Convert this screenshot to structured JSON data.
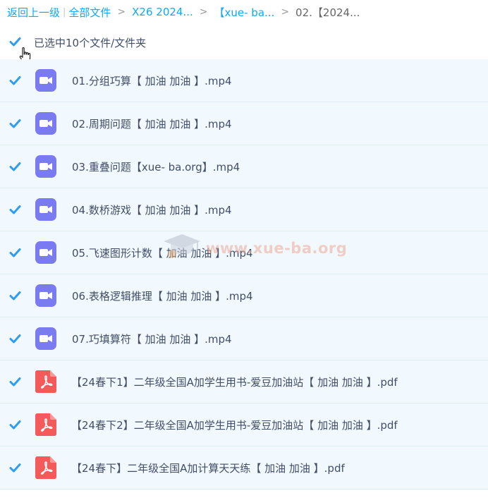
{
  "breadcrumb": {
    "back": "返回上一级",
    "all_files": "全部文件",
    "crumb1": "X26 2024...",
    "crumb2": "【xue- ba...",
    "current": "02.【2024...",
    "separator": ">",
    "pipe": "|"
  },
  "selection": {
    "label": "已选中10个文件/文件夹"
  },
  "files": [
    {
      "name": "01.分组巧算【 加油 加油 】.mp4",
      "type": "video-icon"
    },
    {
      "name": "02.周期问题【 加油 加油 】.mp4",
      "type": "video-icon"
    },
    {
      "name": "03.重叠问题【xue- ba.org】.mp4",
      "type": "video-icon"
    },
    {
      "name": "04.数桥游戏【 加油 加油 】.mp4",
      "type": "video-icon"
    },
    {
      "name": "05.飞速图形计数【 加油 加油 】.mp4",
      "type": "video-icon"
    },
    {
      "name": "06.表格逻辑推理【 加油 加油 】.mp4",
      "type": "video-icon"
    },
    {
      "name": "07.巧填算符【 加油 加油 】.mp4",
      "type": "video-icon"
    },
    {
      "name": "【24春下1】二年级全国A加学生用书-爱豆加油站【 加油 加油 】.pdf",
      "type": "pdf-icon"
    },
    {
      "name": "【24春下2】二年级全国A加学生用书-爱豆加油站【 加油 加油 】.pdf",
      "type": "pdf-icon"
    },
    {
      "name": "【24春下】二年级全国A加计算天天练【 加油 加油 】.pdf",
      "type": "pdf-icon"
    }
  ],
  "watermark": {
    "text": "www.xue-ba.org"
  },
  "colors": {
    "accent": "#09aaff",
    "checkbox": "#2e9cf0",
    "video_icon": "#7a7bf0",
    "pdf_icon": "#f55a5a",
    "row_bg": "#f1f8fe"
  }
}
